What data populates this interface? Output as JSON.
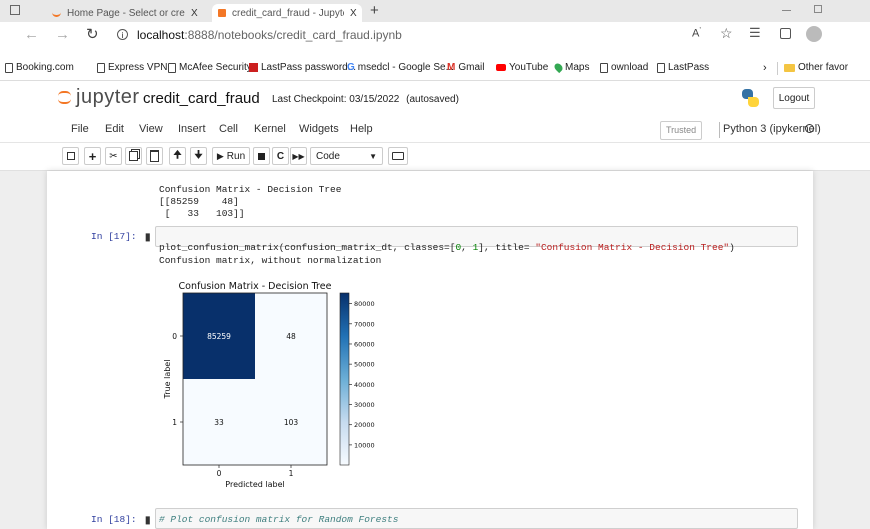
{
  "browser": {
    "tabs": [
      {
        "title": "Home Page - Select or create a n",
        "close": "X"
      },
      {
        "title": "credit_card_fraud - Jupyter Note",
        "close": "X"
      }
    ],
    "new_tab": "+",
    "url_host": "localhost",
    "url_path": ":8888/notebooks/credit_card_fraud.ipynb",
    "bookmarks": [
      "Booking.com",
      "Express VPN",
      "McAfee Security",
      "LastPass password...",
      "msedcl - Google Se...",
      "Gmail",
      "YouTube",
      "Maps",
      "ownload",
      "LastPass"
    ],
    "other_favorites": "Other favor"
  },
  "jupyter": {
    "logo_text": "jupyter",
    "notebook_name": "credit_card_fraud",
    "checkpoint": "Last Checkpoint: 03/15/2022",
    "autosave": "(autosaved)",
    "logout": "Logout",
    "menus": [
      "File",
      "Edit",
      "View",
      "Insert",
      "Cell",
      "Kernel",
      "Widgets",
      "Help"
    ],
    "trusted": "Trusted",
    "kernel": "Python 3 (ipykernel)",
    "toolbar": {
      "run_label": "Run",
      "cell_type": "Code"
    }
  },
  "cells": {
    "prev_output": [
      "Confusion Matrix - Decision Tree",
      "[[85259    48]",
      " [   33   103]]"
    ],
    "cell17_prompt": "In [17]:",
    "cell17_code_fn": "plot_confusion_matrix(confusion_matrix_dt, classes=[",
    "cell17_code_n0": "0",
    "cell17_code_sep": ", ",
    "cell17_code_n1": "1",
    "cell17_code_mid": "], title= ",
    "cell17_code_str": "\"Confusion Matrix - Decision Tree\"",
    "cell17_code_end": ")",
    "cell17_output": "Confusion matrix, without normalization",
    "cell18_prompt": "In [18]:",
    "cell18_code": "# Plot confusion matrix for Random Forests"
  },
  "chart_data": {
    "type": "heatmap",
    "title": "Confusion Matrix - Decision Tree",
    "xlabel": "Predicted label",
    "ylabel": "True label",
    "x_ticks": [
      "0",
      "1"
    ],
    "y_ticks": [
      "0",
      "1"
    ],
    "matrix": [
      [
        85259,
        48
      ],
      [
        33,
        103
      ]
    ],
    "colormap": "Blues",
    "colorbar_ticks": [
      10000,
      20000,
      30000,
      40000,
      50000,
      60000,
      70000,
      80000
    ],
    "colorbar_range": [
      33,
      85259
    ],
    "colors": {
      "high": "#08306b",
      "low": "#f7fbff"
    }
  }
}
